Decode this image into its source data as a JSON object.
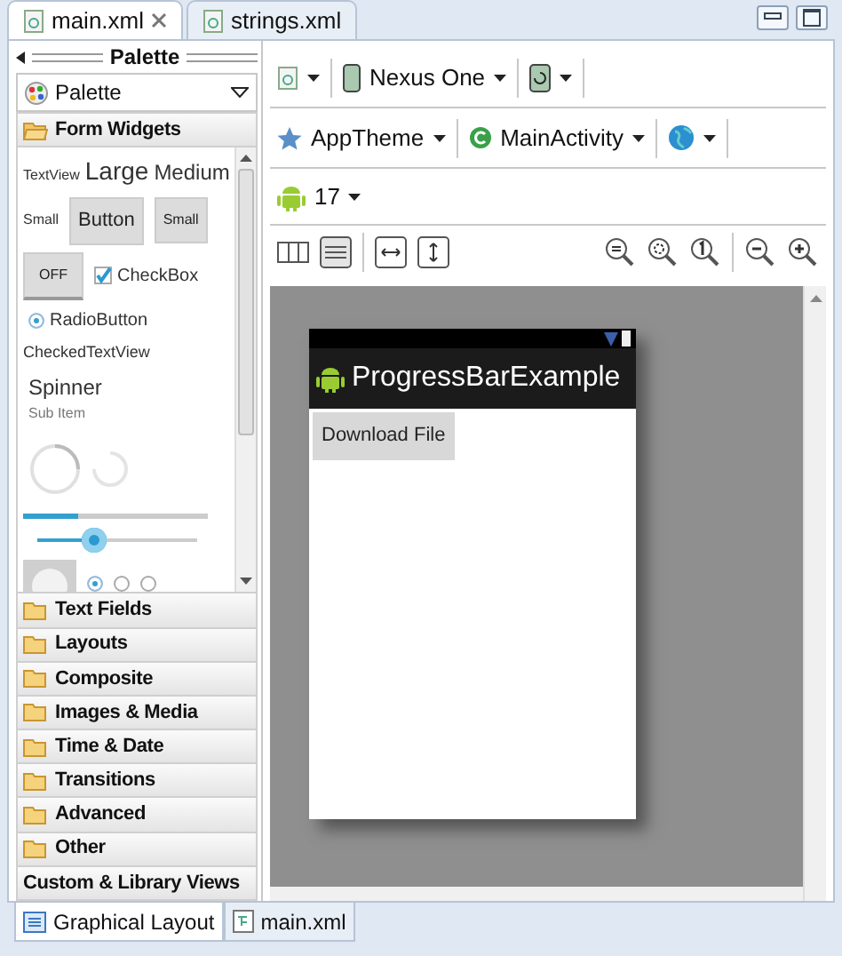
{
  "editor_tabs": [
    {
      "label": "main.xml",
      "selected": true,
      "closable": true
    },
    {
      "label": "strings.xml",
      "selected": false,
      "closable": false
    }
  ],
  "palette": {
    "title": "Palette",
    "dropdown": "Palette",
    "categories": [
      {
        "label": "Form Widgets",
        "kind": "folder",
        "expanded": true
      },
      {
        "label": "Text Fields",
        "kind": "folder",
        "expanded": false
      },
      {
        "label": "Layouts",
        "kind": "folder",
        "expanded": false
      },
      {
        "label": "Composite",
        "kind": "folder",
        "expanded": false
      },
      {
        "label": "Images & Media",
        "kind": "folder",
        "expanded": false
      },
      {
        "label": "Time & Date",
        "kind": "folder",
        "expanded": false
      },
      {
        "label": "Transitions",
        "kind": "folder",
        "expanded": false
      },
      {
        "label": "Advanced",
        "kind": "folder",
        "expanded": false
      },
      {
        "label": "Other",
        "kind": "folder",
        "expanded": false
      },
      {
        "label": "Custom & Library Views",
        "kind": "plain",
        "expanded": false
      }
    ],
    "widgets": {
      "text_sizes": [
        "TextView",
        "Large",
        "Medium"
      ],
      "small_label": "Small",
      "buttons": [
        "Button",
        "Small"
      ],
      "toggle": "OFF",
      "checkbox": {
        "label": "CheckBox",
        "checked": true
      },
      "radio": {
        "label": "RadioButton",
        "checked": true
      },
      "checked_text": "CheckedTextView",
      "spinner": {
        "label": "Spinner",
        "sub": "Sub Item"
      },
      "progress": {
        "level": 0.3
      },
      "seekbar": {
        "level": 0.35
      },
      "radio_group": [
        {
          "selected": true
        },
        {
          "selected": false
        },
        {
          "selected": false
        }
      ]
    }
  },
  "toolbar": {
    "device": "Nexus One",
    "theme": "AppTheme",
    "activity": "MainActivity",
    "api_level": "17"
  },
  "canvas": {
    "app_title": "ProgressBarExample",
    "button": "Download File"
  },
  "bottom_tabs": [
    {
      "label": "Graphical Layout",
      "selected": true
    },
    {
      "label": "main.xml",
      "selected": false
    }
  ]
}
